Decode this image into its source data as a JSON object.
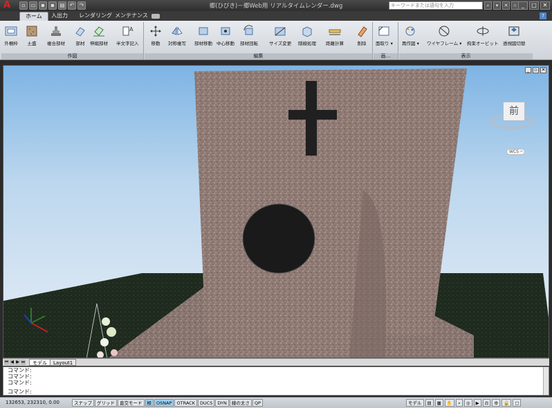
{
  "titlebar": {
    "title": "郷(ひびき)－郷Web用 リアルタイムレンダー.dwg",
    "search_placeholder": "キーワードまたは語句を入力",
    "app_logo": "A"
  },
  "tabs": [
    {
      "label": "ホーム",
      "active": true
    },
    {
      "label": "入出力"
    },
    {
      "label": "レンダリング"
    },
    {
      "label": "メンテナンス"
    }
  ],
  "ribbon": {
    "panels": [
      {
        "title": "作図",
        "buttons": [
          "外柵枠",
          "土盛",
          "複合部材",
          "部材",
          "伸縮部材",
          "半文字記入"
        ]
      },
      {
        "title": "編集",
        "buttons": [
          "移動",
          "対称複写",
          "部材移動",
          "中心移動",
          "部材回転",
          "サイズ変更",
          "隠線処理",
          "距離計算",
          "削除"
        ]
      },
      {
        "title": "画…",
        "buttons": [
          "面取り ▾"
        ]
      },
      {
        "title": "表示",
        "buttons": [
          "再作図 ▾",
          "ワイヤフレーム ▾",
          "拘束オービット",
          "透視図切替"
        ]
      }
    ]
  },
  "viewport": {
    "viewcube_label": "前",
    "wcs_label": "WCS ─"
  },
  "layout_tabs": [
    "モデル",
    "Layout1"
  ],
  "command": {
    "lines": [
      "コマンド:",
      "コマンド:",
      "コマンド:"
    ],
    "prompt": "コマンド:"
  },
  "status": {
    "coords": "132653, 232310, 0.00",
    "toggles": [
      "スナップ",
      "グリッド",
      "直交モード",
      "極",
      "OSNAP",
      "OTRACK",
      "DUCS",
      "DYN",
      "線の太さ",
      "QP"
    ],
    "model_label": "モデル"
  }
}
